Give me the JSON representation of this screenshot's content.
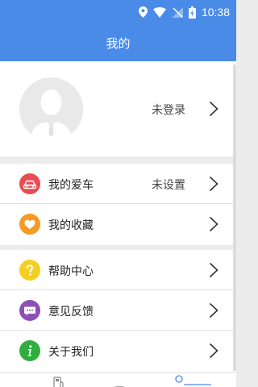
{
  "status_bar": {
    "time": "10:38"
  },
  "header": {
    "title": "我的"
  },
  "profile": {
    "login_status": "未登录"
  },
  "menu": {
    "car": {
      "label": "我的爱车",
      "value": "未设置",
      "icon_color": "#ea4b52"
    },
    "favorites": {
      "label": "我的收藏",
      "icon_color": "#f39b24"
    },
    "help": {
      "label": "帮助中心",
      "icon_color": "#f5cf1f"
    },
    "feedback": {
      "label": "意见反馈",
      "icon_color": "#8e4fb4"
    },
    "about": {
      "label": "关于我们",
      "icon_color": "#2fae3f"
    }
  },
  "colors": {
    "header": "#4a8be8",
    "background": "#ececec"
  }
}
